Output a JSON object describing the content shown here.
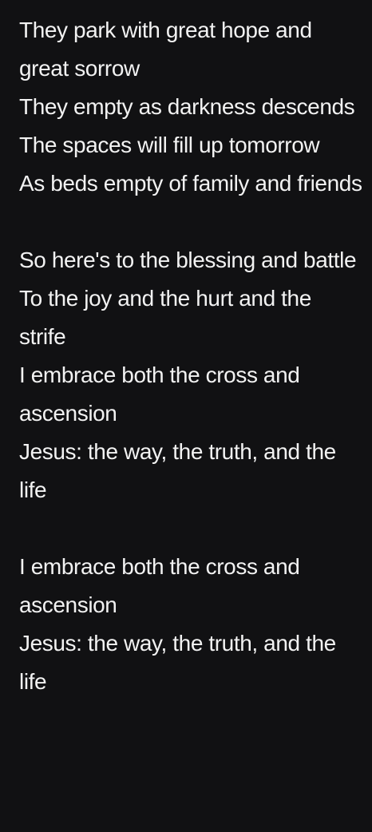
{
  "poem": {
    "stanzas": [
      {
        "lines": [
          "They park with great hope and great sorrow",
          "They empty as darkness descends",
          "The spaces will fill up tomorrow",
          "As beds empty of family and friends"
        ]
      },
      {
        "lines": [
          "So here's to the blessing and battle",
          "To the joy and the hurt and the strife",
          "I embrace both the cross and ascension",
          "Jesus: the way, the truth, and the life"
        ]
      },
      {
        "lines": [
          "I embrace both the cross and ascension",
          "Jesus: the way, the truth, and the life"
        ]
      }
    ]
  },
  "colors": {
    "background": "#111113",
    "text": "#f2f2f2"
  }
}
